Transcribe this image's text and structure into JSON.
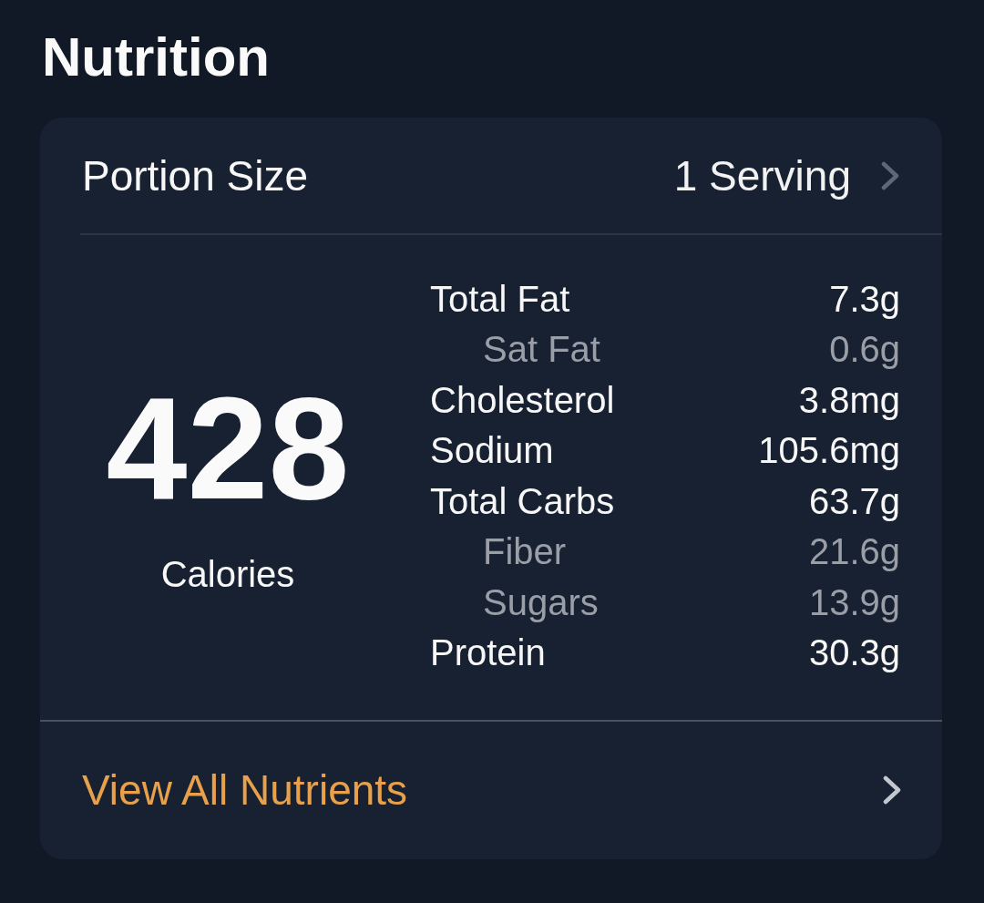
{
  "title": "Nutrition",
  "portion": {
    "label": "Portion Size",
    "value": "1 Serving"
  },
  "calories": {
    "value": "428",
    "label": "Calories"
  },
  "nutrients": [
    {
      "name": "Total Fat",
      "amount": "7.3g",
      "kind": "main"
    },
    {
      "name": "Sat Fat",
      "amount": "0.6g",
      "kind": "sub"
    },
    {
      "name": "Cholesterol",
      "amount": "3.8mg",
      "kind": "main"
    },
    {
      "name": "Sodium",
      "amount": "105.6mg",
      "kind": "main"
    },
    {
      "name": "Total Carbs",
      "amount": "63.7g",
      "kind": "main"
    },
    {
      "name": "Fiber",
      "amount": "21.6g",
      "kind": "sub"
    },
    {
      "name": "Sugars",
      "amount": "13.9g",
      "kind": "sub"
    },
    {
      "name": "Protein",
      "amount": "30.3g",
      "kind": "main"
    }
  ],
  "view_all": {
    "label": "View All Nutrients"
  }
}
